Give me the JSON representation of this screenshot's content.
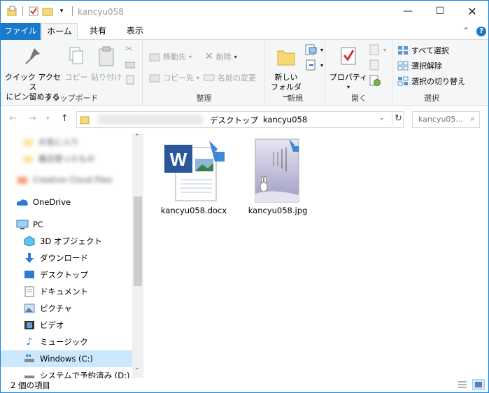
{
  "window": {
    "title": "kancyu058"
  },
  "ribbon_tabs": {
    "file": "ファイル",
    "home": "ホーム",
    "share": "共有",
    "view": "表示"
  },
  "clipboard": {
    "pin": "クイック アクセス\nにピン留めする",
    "copy": "コピー",
    "paste": "貼り付け",
    "label": "クリップボード"
  },
  "organize": {
    "move_to": "移動先",
    "copy_to": "コピー先",
    "delete": "削除",
    "rename": "名前の変更",
    "label": "整理"
  },
  "new": {
    "new_folder": "新しい\nフォルダー",
    "label": "新規"
  },
  "open": {
    "properties": "プロパティ",
    "label": "開く"
  },
  "select": {
    "select_all": "すべて選択",
    "select_none": "選択解除",
    "invert": "選択の切り替え",
    "label": "選択"
  },
  "address": {
    "path": [
      "デスクトップ",
      "kancyu058"
    ],
    "search_placeholder": "kancyu05..."
  },
  "nav": {
    "blurred": [
      "お気に入り",
      "最近使ったもの",
      "Creative Cloud Files"
    ],
    "items": [
      {
        "label": "OneDrive",
        "icon": "cloud-icon"
      },
      {
        "label": "PC",
        "icon": "pc-icon"
      },
      {
        "label": "3D オブジェクト",
        "icon": "cube-icon"
      },
      {
        "label": "ダウンロード",
        "icon": "download-icon"
      },
      {
        "label": "デスクトップ",
        "icon": "desktop-icon"
      },
      {
        "label": "ドキュメント",
        "icon": "document-icon"
      },
      {
        "label": "ピクチャ",
        "icon": "picture-icon"
      },
      {
        "label": "ビデオ",
        "icon": "video-icon"
      },
      {
        "label": "ミュージック",
        "icon": "music-icon"
      },
      {
        "label": "Windows (C:)",
        "icon": "drive-icon"
      },
      {
        "label": "システムで予約済み (D:)",
        "icon": "drive-icon"
      }
    ]
  },
  "files": [
    {
      "name": "kancyu058.docx",
      "type": "word"
    },
    {
      "name": "kancyu058.jpg",
      "type": "image"
    }
  ],
  "status": {
    "count": "2 個の項目"
  },
  "colors": {
    "accent": "#1979ca",
    "selected": "#cce8ff",
    "word_blue": "#2b579a",
    "folder": "#f8d775"
  }
}
